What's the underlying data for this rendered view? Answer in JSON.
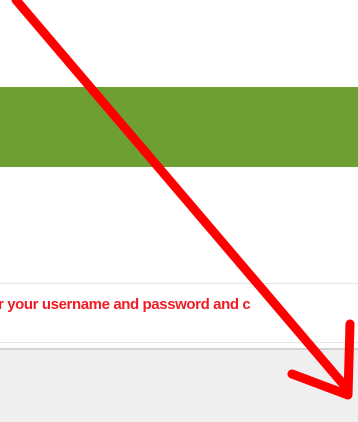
{
  "login": {
    "error_message": "r your username and password and c"
  },
  "colors": {
    "banner": "#6e9f33",
    "error_text": "#ee1c25",
    "annotation_arrow": "#ff0000",
    "footer": "#efefef"
  },
  "icons": {
    "annotation": "red-arrow-icon"
  }
}
